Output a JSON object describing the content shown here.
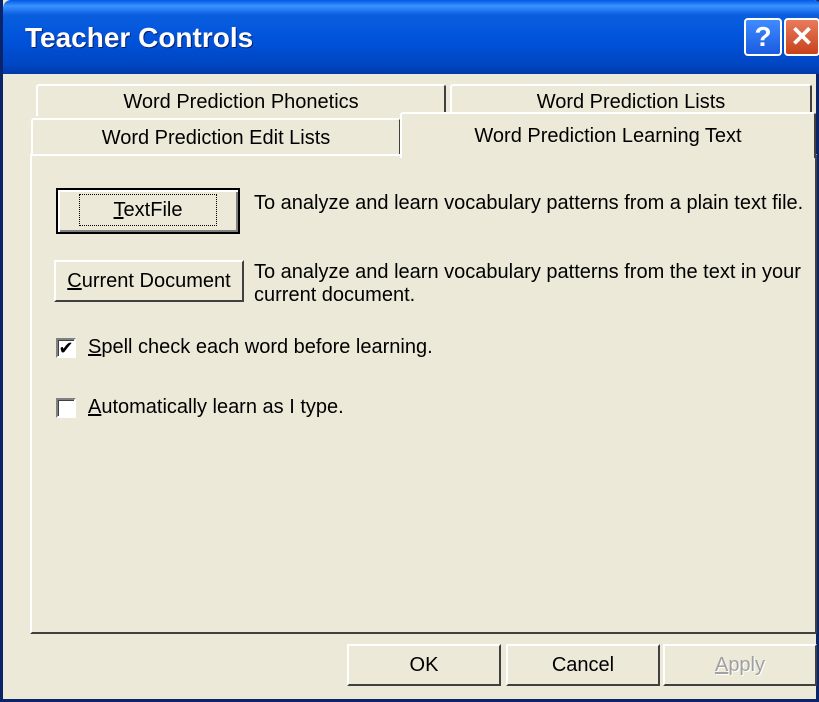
{
  "window": {
    "title": "Teacher Controls",
    "help_glyph": "?",
    "close_glyph": "✕"
  },
  "tabs": {
    "phonetics": "Word Prediction Phonetics",
    "lists": "Word Prediction Lists",
    "edit_lists": "Word Prediction Edit Lists",
    "learning_text": "Word Prediction Learning Text"
  },
  "panel": {
    "textfile_button": {
      "mnemonic": "T",
      "rest": "extFile"
    },
    "textfile_desc": "To analyze and learn vocabulary patterns from a plain text file.",
    "current_doc_button": {
      "mnemonic": "C",
      "rest": "urrent Document"
    },
    "current_doc_desc": "To analyze and learn vocabulary patterns from the text in your current document.",
    "spell_check": {
      "mnemonic": "S",
      "rest": "pell check each word before learning.",
      "checked": true,
      "check_glyph": "✔"
    },
    "auto_learn": {
      "mnemonic": "A",
      "rest": "utomatically learn as I type.",
      "checked": false
    }
  },
  "footer": {
    "ok": "OK",
    "cancel": "Cancel",
    "apply": {
      "mnemonic": "A",
      "rest": "pply"
    }
  },
  "colors": {
    "face": "#ece9d8",
    "title_blue": "#0052d9",
    "close_red": "#c8421a"
  }
}
